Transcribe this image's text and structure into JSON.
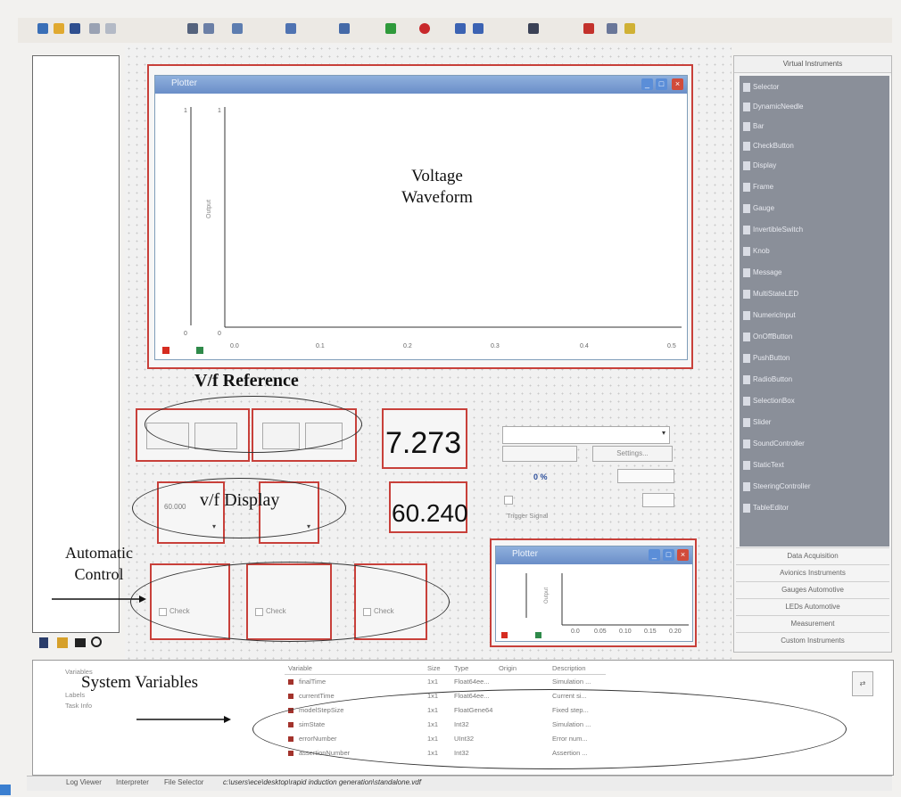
{
  "annotations": {
    "voltage_waveform_line1": "Voltage",
    "voltage_waveform_line2": "Waveform",
    "vf_reference": "V/f Reference",
    "vf_display": "v/f Display",
    "automatic_control_line1": "Automatic",
    "automatic_control_line2": "Control",
    "system_variables": "System Variables"
  },
  "plotter_main": {
    "title": "Plotter",
    "y_ticks": [
      "1",
      "1",
      "0",
      "0"
    ],
    "x_ticks": [
      "0.0",
      "0.1",
      "0.2",
      "0.3",
      "0.4",
      "0.5"
    ]
  },
  "plotter_small": {
    "title": "Plotter",
    "x_ticks": [
      "0.0",
      "0.05",
      "0.10",
      "0.15",
      "0.20"
    ]
  },
  "displays": {
    "value_1": "7.273",
    "value_2": "60.240",
    "field_value": "60.000",
    "progress": "0 %",
    "settings_label": "Settings...",
    "trigger_label": "Trigger Signal",
    "check_label": "Check"
  },
  "right_panel": {
    "header": "Virtual Instruments",
    "items": [
      "Selector",
      "DynamicNeedle",
      "Bar",
      "CheckButton",
      "Display",
      "Frame",
      "Gauge",
      "InvertibleSwitch",
      "Knob",
      "Message",
      "MultiStateLED",
      "NumericInput",
      "OnOffButton",
      "PushButton",
      "RadioButton",
      "SelectionBox",
      "Slider",
      "SoundController",
      "StaticText",
      "SteeringController",
      "TableEditor"
    ],
    "tabs": [
      "Data Acquisition",
      "Avionics Instruments",
      "Gauges Automotive",
      "LEDs Automotive",
      "Measurement",
      "Custom Instruments"
    ]
  },
  "variables": {
    "tree": [
      "Variables",
      "Labels",
      "Task Info"
    ],
    "headers": [
      "Variable",
      "Size",
      "Type",
      "Origin",
      "Description"
    ],
    "rows": [
      {
        "name": "finalTime",
        "size": "1x1",
        "type": "Float64ee...",
        "desc": "Simulation ..."
      },
      {
        "name": "currentTime",
        "size": "1x1",
        "type": "Float64ee...",
        "desc": "Current si..."
      },
      {
        "name": "modelStepSize",
        "size": "1x1",
        "type": "FloatGene64",
        "desc": "Fixed step..."
      },
      {
        "name": "simState",
        "size": "1x1",
        "type": "Int32",
        "desc": "Simulation ..."
      },
      {
        "name": "errorNumber",
        "size": "1x1",
        "type": "UInt32",
        "desc": "Error num..."
      },
      {
        "name": "assertionNumber",
        "size": "1x1",
        "type": "Int32",
        "desc": "Assertion ..."
      }
    ]
  },
  "status_tabs": [
    "Log Viewer",
    "Interpreter",
    "File Selector",
    "c:\\users\\ece\\desktop\\rapid induction generation\\standalone.vdf"
  ]
}
